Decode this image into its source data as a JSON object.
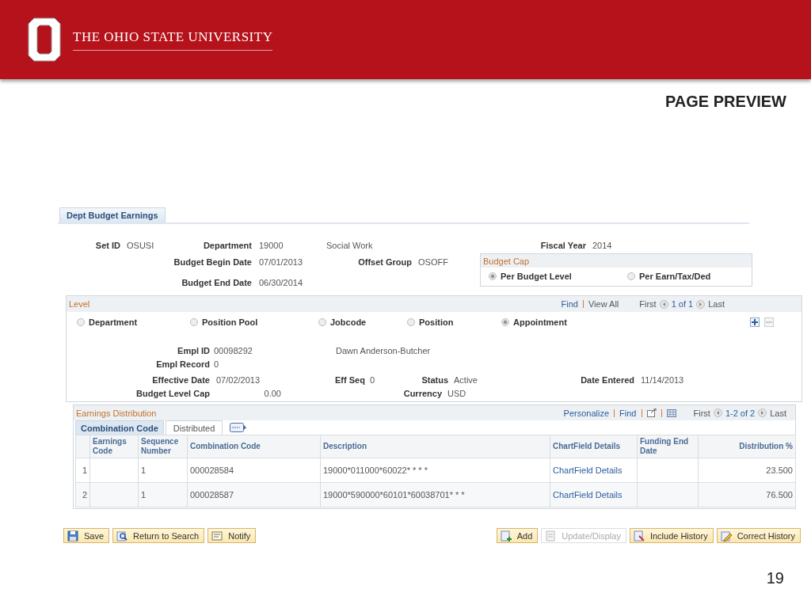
{
  "header": {
    "title": "THE OHIO STATE UNIVERSITY"
  },
  "heading": "PAGE PREVIEW",
  "page_tab": {
    "label": "Dept Budget Earnings",
    "selected": true
  },
  "top": {
    "set_id": {
      "label": "Set ID",
      "value": "OSUSI"
    },
    "department": {
      "label": "Department",
      "value": "19000",
      "description": "Social Work"
    },
    "fiscal_year": {
      "label": "Fiscal Year",
      "value": "2014"
    },
    "begin_date": {
      "label": "Budget Begin Date",
      "value": "07/01/2013"
    },
    "offset_group": {
      "label": "Offset Group",
      "value": "OSOFF"
    },
    "end_date": {
      "label": "Budget End Date",
      "value": "06/30/2014"
    }
  },
  "budget_cap": {
    "title": "Budget Cap",
    "options": [
      {
        "label": "Per Budget Level",
        "selected": true
      },
      {
        "label": "Per Earn/Tax/Ded",
        "selected": false
      }
    ]
  },
  "level": {
    "title": "Level",
    "find": "Find",
    "view_all": "View All",
    "first": "First",
    "count": "1 of 1",
    "last": "Last",
    "options": [
      {
        "label": "Department",
        "selected": false
      },
      {
        "label": "Position Pool",
        "selected": false
      },
      {
        "label": "Jobcode",
        "selected": false
      },
      {
        "label": "Position",
        "selected": false
      },
      {
        "label": "Appointment",
        "selected": true
      }
    ],
    "empl_id": {
      "label": "Empl ID",
      "value": "00098292",
      "name": "Dawn Anderson-Butcher"
    },
    "empl_record": {
      "label": "Empl Record",
      "value": "0"
    },
    "effective_date": {
      "label": "Effective Date",
      "value": "07/02/2013"
    },
    "eff_seq": {
      "label": "Eff Seq",
      "value": "0"
    },
    "status": {
      "label": "Status",
      "value": "Active"
    },
    "date_entered": {
      "label": "Date Entered",
      "value": "11/14/2013"
    },
    "budget_level_cap": {
      "label": "Budget Level Cap",
      "value": "0.00"
    },
    "currency": {
      "label": "Currency",
      "value": "USD"
    }
  },
  "earnings": {
    "title": "Earnings Distribution",
    "personalize": "Personalize",
    "find": "Find",
    "first": "First",
    "count": "1-2 of 2",
    "last": "Last",
    "tabs": [
      {
        "label": "Combination Code",
        "selected": true
      },
      {
        "label": "Distributed",
        "selected": false
      }
    ],
    "columns": [
      "Earnings Code",
      "Sequence Number",
      "Combination Code",
      "Description",
      "ChartField Details",
      "Funding End Date",
      "Distribution %"
    ],
    "rows": [
      {
        "number": "1",
        "sequence_number": "1",
        "combination_code": "000028584",
        "description": "19000*011000*60022* * * *",
        "chartfield_details": "ChartField Details",
        "distribution": "23.500"
      },
      {
        "number": "2",
        "sequence_number": "1",
        "combination_code": "000028587",
        "description": "19000*590000*60101*60038701* * *",
        "chartfield_details": "ChartField Details",
        "distribution": "76.500"
      }
    ]
  },
  "buttons": [
    {
      "kind": "save",
      "label": "Save",
      "disabled": false
    },
    {
      "kind": "return",
      "label": "Return to Search",
      "disabled": false
    },
    {
      "kind": "notify",
      "label": "Notify",
      "disabled": false
    },
    {
      "kind": "add",
      "label": "Add",
      "disabled": false
    },
    {
      "kind": "update",
      "label": "Update/Display",
      "disabled": true
    },
    {
      "kind": "include",
      "label": "Include History",
      "disabled": false
    },
    {
      "kind": "correct",
      "label": "Correct History",
      "disabled": false
    }
  ],
  "slide_number": "19"
}
